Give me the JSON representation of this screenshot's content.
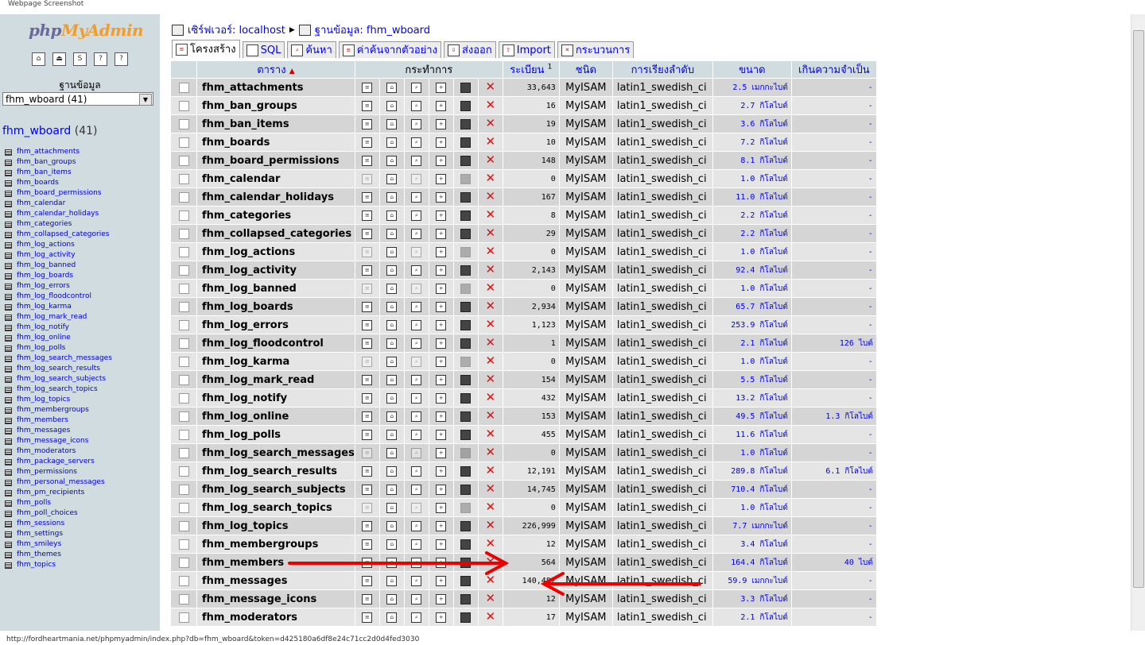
{
  "window_caption": "Webpage Screenshot",
  "status_url": "http://fordheartmania.net/phpmyadmin/index.php?db=fhm_wboard&token=d425180a6df8e24c71cc2d0d4fed3030",
  "left": {
    "logo_php": "php",
    "logo_myadmin": "MyAdmin",
    "db_label": "ฐานข้อมูล",
    "db_select_value": "fhm_wboard (41)",
    "db_name": "fhm_wboard",
    "db_count": "(41)",
    "tables": [
      "fhm_attachments",
      "fhm_ban_groups",
      "fhm_ban_items",
      "fhm_boards",
      "fhm_board_permissions",
      "fhm_calendar",
      "fhm_calendar_holidays",
      "fhm_categories",
      "fhm_collapsed_categories",
      "fhm_log_actions",
      "fhm_log_activity",
      "fhm_log_banned",
      "fhm_log_boards",
      "fhm_log_errors",
      "fhm_log_floodcontrol",
      "fhm_log_karma",
      "fhm_log_mark_read",
      "fhm_log_notify",
      "fhm_log_online",
      "fhm_log_polls",
      "fhm_log_search_messages",
      "fhm_log_search_results",
      "fhm_log_search_subjects",
      "fhm_log_search_topics",
      "fhm_log_topics",
      "fhm_membergroups",
      "fhm_members",
      "fhm_messages",
      "fhm_message_icons",
      "fhm_moderators",
      "fhm_package_servers",
      "fhm_permissions",
      "fhm_personal_messages",
      "fhm_pm_recipients",
      "fhm_polls",
      "fhm_poll_choices",
      "fhm_sessions",
      "fhm_settings",
      "fhm_smileys",
      "fhm_themes",
      "fhm_topics"
    ]
  },
  "breadcrumb": {
    "server": "เซิร์ฟเวอร์: localhost",
    "database": "ฐานข้อมูล: fhm_wboard"
  },
  "tabs": [
    {
      "label": "โครงสร้าง",
      "active": true
    },
    {
      "label": "SQL",
      "active": false
    },
    {
      "label": "ค้นหา",
      "active": false
    },
    {
      "label": "ค่าค้นจากตัวอย่าง",
      "active": false
    },
    {
      "label": "ส่งออก",
      "active": false
    },
    {
      "label": "Import",
      "active": false
    },
    {
      "label": "กระบวนการ",
      "active": false
    }
  ],
  "columns": {
    "table": "ตาราง",
    "sort_arrow": "▲",
    "action": "กระทำการ",
    "records": "ระเบียน",
    "records_sup": "1",
    "type": "ชนิด",
    "collation": "การเรียงลำดับ",
    "size": "ขนาด",
    "overhead": "เกินความจำเป็น"
  },
  "rows": [
    {
      "name": "fhm_attachments",
      "records": "33,643",
      "type": "MyISAM",
      "collation": "latin1_swedish_ci",
      "size": "2.5 เมกกะไบต์",
      "overhead": "-",
      "empty": false
    },
    {
      "name": "fhm_ban_groups",
      "records": "16",
      "type": "MyISAM",
      "collation": "latin1_swedish_ci",
      "size": "2.7 กิโลไบต์",
      "overhead": "-",
      "empty": false
    },
    {
      "name": "fhm_ban_items",
      "records": "19",
      "type": "MyISAM",
      "collation": "latin1_swedish_ci",
      "size": "3.6 กิโลไบต์",
      "overhead": "-",
      "empty": false
    },
    {
      "name": "fhm_boards",
      "records": "10",
      "type": "MyISAM",
      "collation": "latin1_swedish_ci",
      "size": "7.2 กิโลไบต์",
      "overhead": "-",
      "empty": false
    },
    {
      "name": "fhm_board_permissions",
      "records": "148",
      "type": "MyISAM",
      "collation": "latin1_swedish_ci",
      "size": "8.1 กิโลไบต์",
      "overhead": "-",
      "empty": false
    },
    {
      "name": "fhm_calendar",
      "records": "0",
      "type": "MyISAM",
      "collation": "latin1_swedish_ci",
      "size": "1.0 กิโลไบต์",
      "overhead": "-",
      "empty": true
    },
    {
      "name": "fhm_calendar_holidays",
      "records": "167",
      "type": "MyISAM",
      "collation": "latin1_swedish_ci",
      "size": "11.0 กิโลไบต์",
      "overhead": "-",
      "empty": false
    },
    {
      "name": "fhm_categories",
      "records": "8",
      "type": "MyISAM",
      "collation": "latin1_swedish_ci",
      "size": "2.2 กิโลไบต์",
      "overhead": "-",
      "empty": false
    },
    {
      "name": "fhm_collapsed_categories",
      "records": "29",
      "type": "MyISAM",
      "collation": "latin1_swedish_ci",
      "size": "2.2 กิโลไบต์",
      "overhead": "-",
      "empty": false
    },
    {
      "name": "fhm_log_actions",
      "records": "0",
      "type": "MyISAM",
      "collation": "latin1_swedish_ci",
      "size": "1.0 กิโลไบต์",
      "overhead": "-",
      "empty": true
    },
    {
      "name": "fhm_log_activity",
      "records": "2,143",
      "type": "MyISAM",
      "collation": "latin1_swedish_ci",
      "size": "92.4 กิโลไบต์",
      "overhead": "-",
      "empty": false
    },
    {
      "name": "fhm_log_banned",
      "records": "0",
      "type": "MyISAM",
      "collation": "latin1_swedish_ci",
      "size": "1.0 กิโลไบต์",
      "overhead": "-",
      "empty": true
    },
    {
      "name": "fhm_log_boards",
      "records": "2,934",
      "type": "MyISAM",
      "collation": "latin1_swedish_ci",
      "size": "65.7 กิโลไบต์",
      "overhead": "-",
      "empty": false
    },
    {
      "name": "fhm_log_errors",
      "records": "1,123",
      "type": "MyISAM",
      "collation": "latin1_swedish_ci",
      "size": "253.9 กิโลไบต์",
      "overhead": "-",
      "empty": false
    },
    {
      "name": "fhm_log_floodcontrol",
      "records": "1",
      "type": "MyISAM",
      "collation": "latin1_swedish_ci",
      "size": "2.1 กิโลไบต์",
      "overhead": "126 ไบต์",
      "empty": false
    },
    {
      "name": "fhm_log_karma",
      "records": "0",
      "type": "MyISAM",
      "collation": "latin1_swedish_ci",
      "size": "1.0 กิโลไบต์",
      "overhead": "-",
      "empty": true
    },
    {
      "name": "fhm_log_mark_read",
      "records": "154",
      "type": "MyISAM",
      "collation": "latin1_swedish_ci",
      "size": "5.5 กิโลไบต์",
      "overhead": "-",
      "empty": false
    },
    {
      "name": "fhm_log_notify",
      "records": "432",
      "type": "MyISAM",
      "collation": "latin1_swedish_ci",
      "size": "13.2 กิโลไบต์",
      "overhead": "-",
      "empty": false
    },
    {
      "name": "fhm_log_online",
      "records": "153",
      "type": "MyISAM",
      "collation": "latin1_swedish_ci",
      "size": "49.5 กิโลไบต์",
      "overhead": "1.3 กิโลไบต์",
      "empty": false
    },
    {
      "name": "fhm_log_polls",
      "records": "455",
      "type": "MyISAM",
      "collation": "latin1_swedish_ci",
      "size": "11.6 กิโลไบต์",
      "overhead": "-",
      "empty": false
    },
    {
      "name": "fhm_log_search_messages",
      "records": "0",
      "type": "MyISAM",
      "collation": "latin1_swedish_ci",
      "size": "1.0 กิโลไบต์",
      "overhead": "-",
      "empty": true
    },
    {
      "name": "fhm_log_search_results",
      "records": "12,191",
      "type": "MyISAM",
      "collation": "latin1_swedish_ci",
      "size": "289.8 กิโลไบต์",
      "overhead": "6.1 กิโลไบต์",
      "empty": false
    },
    {
      "name": "fhm_log_search_subjects",
      "records": "14,745",
      "type": "MyISAM",
      "collation": "latin1_swedish_ci",
      "size": "710.4 กิโลไบต์",
      "overhead": "-",
      "empty": false
    },
    {
      "name": "fhm_log_search_topics",
      "records": "0",
      "type": "MyISAM",
      "collation": "latin1_swedish_ci",
      "size": "1.0 กิโลไบต์",
      "overhead": "-",
      "empty": true
    },
    {
      "name": "fhm_log_topics",
      "records": "226,999",
      "type": "MyISAM",
      "collation": "latin1_swedish_ci",
      "size": "7.7 เมกกะไบต์",
      "overhead": "-",
      "empty": false
    },
    {
      "name": "fhm_membergroups",
      "records": "12",
      "type": "MyISAM",
      "collation": "latin1_swedish_ci",
      "size": "3.4 กิโลไบต์",
      "overhead": "-",
      "empty": false
    },
    {
      "name": "fhm_members",
      "records": "564",
      "type": "MyISAM",
      "collation": "latin1_swedish_ci",
      "size": "164.4 กิโลไบต์",
      "overhead": "40 ไบต์",
      "empty": false
    },
    {
      "name": "fhm_messages",
      "records": "140,482",
      "type": "MyISAM",
      "collation": "latin1_swedish_ci",
      "size": "59.9 เมกกะไบต์",
      "overhead": "-",
      "empty": false
    },
    {
      "name": "fhm_message_icons",
      "records": "12",
      "type": "MyISAM",
      "collation": "latin1_swedish_ci",
      "size": "3.3 กิโลไบต์",
      "overhead": "-",
      "empty": false
    },
    {
      "name": "fhm_moderators",
      "records": "17",
      "type": "MyISAM",
      "collation": "latin1_swedish_ci",
      "size": "2.1 กิโลไบต์",
      "overhead": "-",
      "empty": false
    }
  ],
  "colors": {
    "sidebar_bg": "#d0dce0",
    "header_bg": "#d0dce0",
    "row_odd": "#d5d5d5",
    "row_even": "#e5e5e5",
    "link": "#0000ee",
    "annotation_arrow": "#ee0000"
  }
}
